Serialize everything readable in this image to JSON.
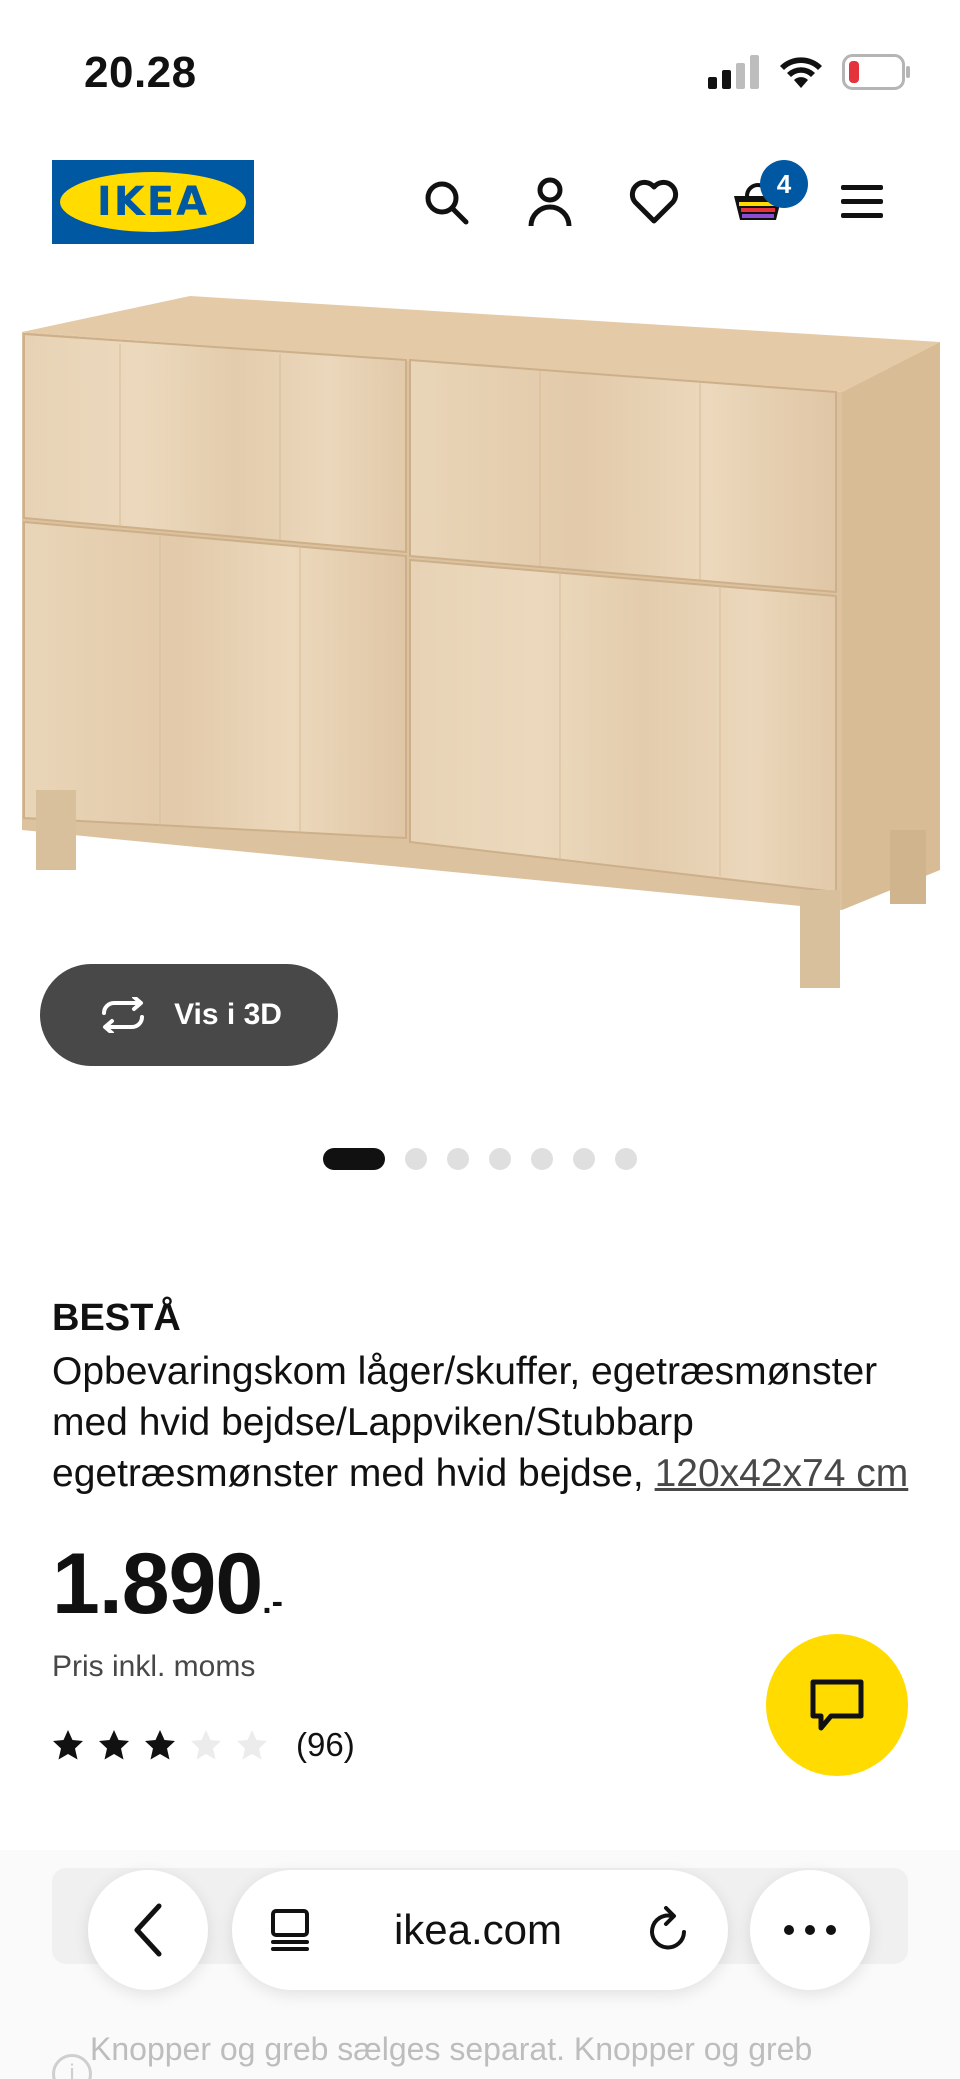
{
  "status_bar": {
    "time": "20.28",
    "battery_color": "#e5333b"
  },
  "header": {
    "logo_text": "IKEA",
    "icons": [
      "search-icon",
      "account-icon",
      "heart-icon",
      "cart-icon",
      "menu-icon"
    ],
    "cart_count": "4",
    "brand_blue": "#0058a3",
    "brand_yellow": "#ffdb00"
  },
  "gallery": {
    "view_3d_label": "Vis i 3D",
    "slides_total": 7,
    "active_slide": 1
  },
  "product": {
    "name": "BESTÅ",
    "description": "Opbevaringskom låger/skuffer, egetræsmønster med hvid bejdse/Lappviken/Stubbarp egetræsmønster med hvid bejdse, ",
    "measure": "120x42x74 cm",
    "price": "1.890",
    "price_suffix": ".-",
    "price_note": "Pris inkl. moms",
    "rating": 3,
    "rating_max": 5,
    "review_count": "(96)"
  },
  "browser": {
    "url": "ikea.com",
    "icons": [
      "back-icon",
      "tabs-icon",
      "reload-icon",
      "more-icon"
    ]
  },
  "notice": {
    "text": "Knopper og greb sælges separat. Knopper og greb"
  }
}
